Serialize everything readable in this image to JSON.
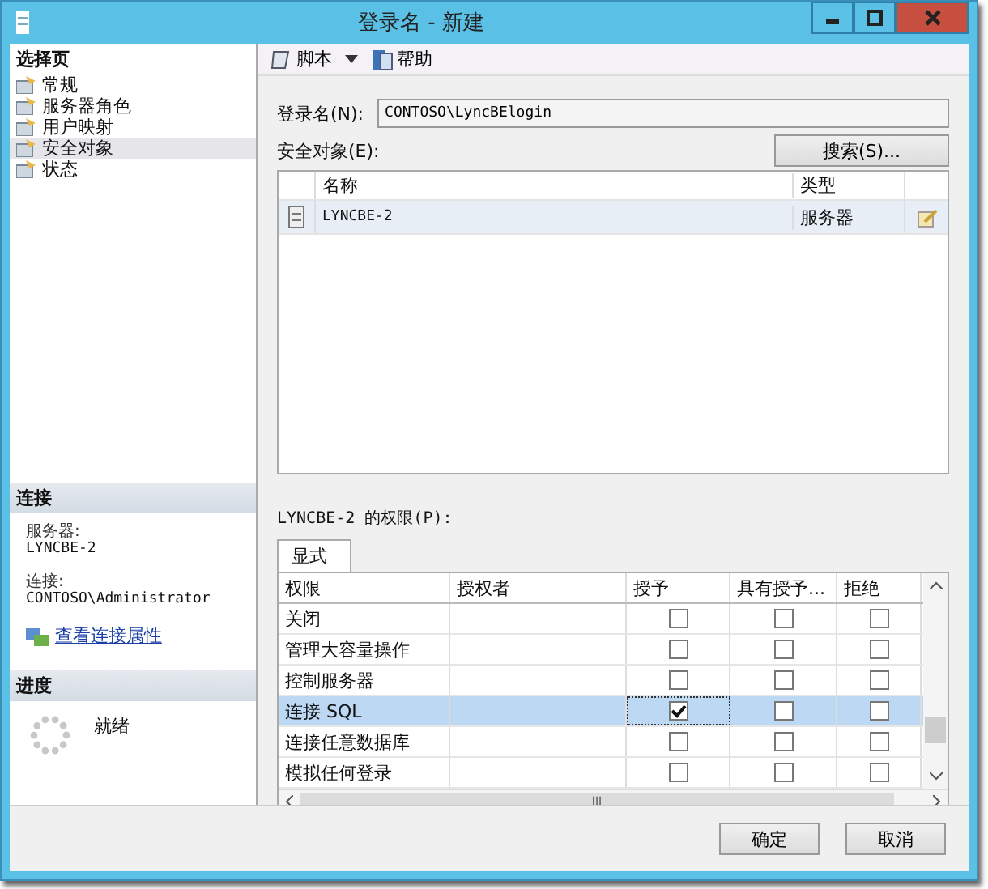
{
  "window": {
    "title": "登录名 - 新建"
  },
  "select_page": {
    "title": "选择页",
    "items": [
      {
        "label": "常规",
        "selected": false
      },
      {
        "label": "服务器角色",
        "selected": false
      },
      {
        "label": "用户映射",
        "selected": false
      },
      {
        "label": "安全对象",
        "selected": true
      },
      {
        "label": "状态",
        "selected": false
      }
    ]
  },
  "connection": {
    "title": "连接",
    "server_label": "服务器:",
    "server": "LYNCBE-2",
    "connection_label": "连接:",
    "connection": "CONTOSO\\Administrator",
    "link": "查看连接属性"
  },
  "progress": {
    "title": "进度",
    "status": "就绪"
  },
  "toolbar": {
    "script": "脚本",
    "help": "帮助"
  },
  "login_name": {
    "label": "登录名(N):",
    "value": "CONTOSO\\LyncBElogin"
  },
  "securables": {
    "label": "安全对象(E):",
    "search_button": "搜索(S)...",
    "columns": [
      "名称",
      "类型"
    ],
    "rows": [
      {
        "name": "LYNCBE-2",
        "type": "服务器",
        "selected": true
      }
    ]
  },
  "permissions": {
    "label": "LYNCBE-2 的权限(P):",
    "tabs": [
      {
        "label": "显式",
        "selected": true
      }
    ],
    "columns": [
      "权限",
      "授权者",
      "授予",
      "具有授予...",
      "拒绝"
    ],
    "rows": [
      {
        "permission": "关闭",
        "grant": false,
        "with_grant": false,
        "deny": false,
        "selected": false
      },
      {
        "permission": "管理大容量操作",
        "grant": false,
        "with_grant": false,
        "deny": false,
        "selected": false
      },
      {
        "permission": "控制服务器",
        "grant": false,
        "with_grant": false,
        "deny": false,
        "selected": false
      },
      {
        "permission": "连接 SQL",
        "grant": true,
        "with_grant": false,
        "deny": false,
        "selected": true
      },
      {
        "permission": "连接任意数据库",
        "grant": false,
        "with_grant": false,
        "deny": false,
        "selected": false
      },
      {
        "permission": "模拟任何登录",
        "grant": false,
        "with_grant": false,
        "deny": false,
        "selected": false
      }
    ],
    "hscroll_grip": "III"
  },
  "buttons": [
    "确定",
    "取消"
  ]
}
